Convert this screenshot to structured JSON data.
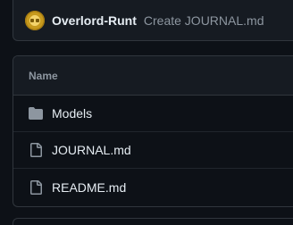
{
  "commit": {
    "author": "Overlord-Runt",
    "message": "Create JOURNAL.md",
    "avatar_icon": "avatar-coin-icon"
  },
  "files": {
    "header_label": "Name",
    "items": [
      {
        "name": "Models",
        "type": "folder",
        "icon": "folder-icon"
      },
      {
        "name": "JOURNAL.md",
        "type": "file",
        "icon": "file-icon"
      },
      {
        "name": "README.md",
        "type": "file",
        "icon": "file-icon"
      }
    ]
  },
  "colors": {
    "background": "#0d1117",
    "surface": "#161b22",
    "border": "#30363d",
    "text_primary": "#e6edf3",
    "text_muted": "#8d96a0",
    "icon": "#8d96a0"
  }
}
